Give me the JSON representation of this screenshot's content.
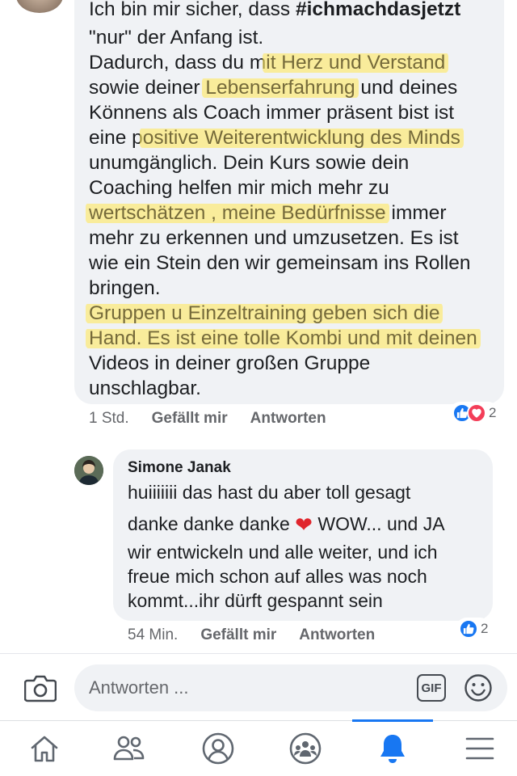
{
  "comment1": {
    "lines": [
      [
        "Ich bin mir sicher, dass ",
        "#ichmachdasjetzt"
      ],
      [
        "\"nur\" der Anfang ist."
      ],
      [
        "Dadurch, dass du m",
        "it Herz und Verstand"
      ],
      [
        "sowie deiner ",
        "Lebenserfahrung",
        " und deines"
      ],
      [
        "Könnens als Coach immer präsent bist ist"
      ],
      [
        "eine p",
        "ositive Weiterentwicklung des Minds"
      ],
      [
        "unumgänglich. Dein  Kurs sowie dein"
      ],
      [
        "Coaching helfen mir mich mehr zu"
      ],
      [
        "wertschätzen , meine Bedürfnisse",
        " immer"
      ],
      [
        "mehr zu erkennen und umzusetzen. Es ist"
      ],
      [
        "wie ein Stein den wir gemeinsam ins Rollen"
      ],
      [
        "bringen."
      ],
      [
        "Gruppen u Einzeltraining geben sich die"
      ],
      [
        "Hand. Es ist eine tolle Kombi und mit deinen"
      ],
      [
        "Videos in deiner großen Gruppe"
      ],
      [
        "unschlagbar."
      ]
    ],
    "time": "1 Std.",
    "like_label": "Gefällt mir",
    "reply_label": "Antworten",
    "reaction_count": "2"
  },
  "reply": {
    "author": "Simone Janak",
    "lines": [
      "huiiiiiii das hast du aber toll gesagt",
      "danke danke danke",
      "WOW... und JA",
      "wir entwickeln und alle weiter, und ich",
      "freue mich schon auf alles was noch",
      "kommt...ihr dürft gespannt sein"
    ],
    "time": "54 Min.",
    "like_label": "Gefällt mir",
    "reply_label": "Antworten",
    "reaction_count": "2"
  },
  "composer": {
    "placeholder": "Antworten ...",
    "gif_label": "GIF"
  },
  "nav": {
    "items": [
      "home-icon",
      "friends-icon",
      "profile-icon",
      "groups-icon",
      "notifications-icon",
      "menu-icon"
    ],
    "active": "notifications-icon"
  },
  "colors": {
    "accent": "#1877f2",
    "love": "#f33e58",
    "highlight": "#ffe964",
    "bubble": "#f0f2f5"
  }
}
